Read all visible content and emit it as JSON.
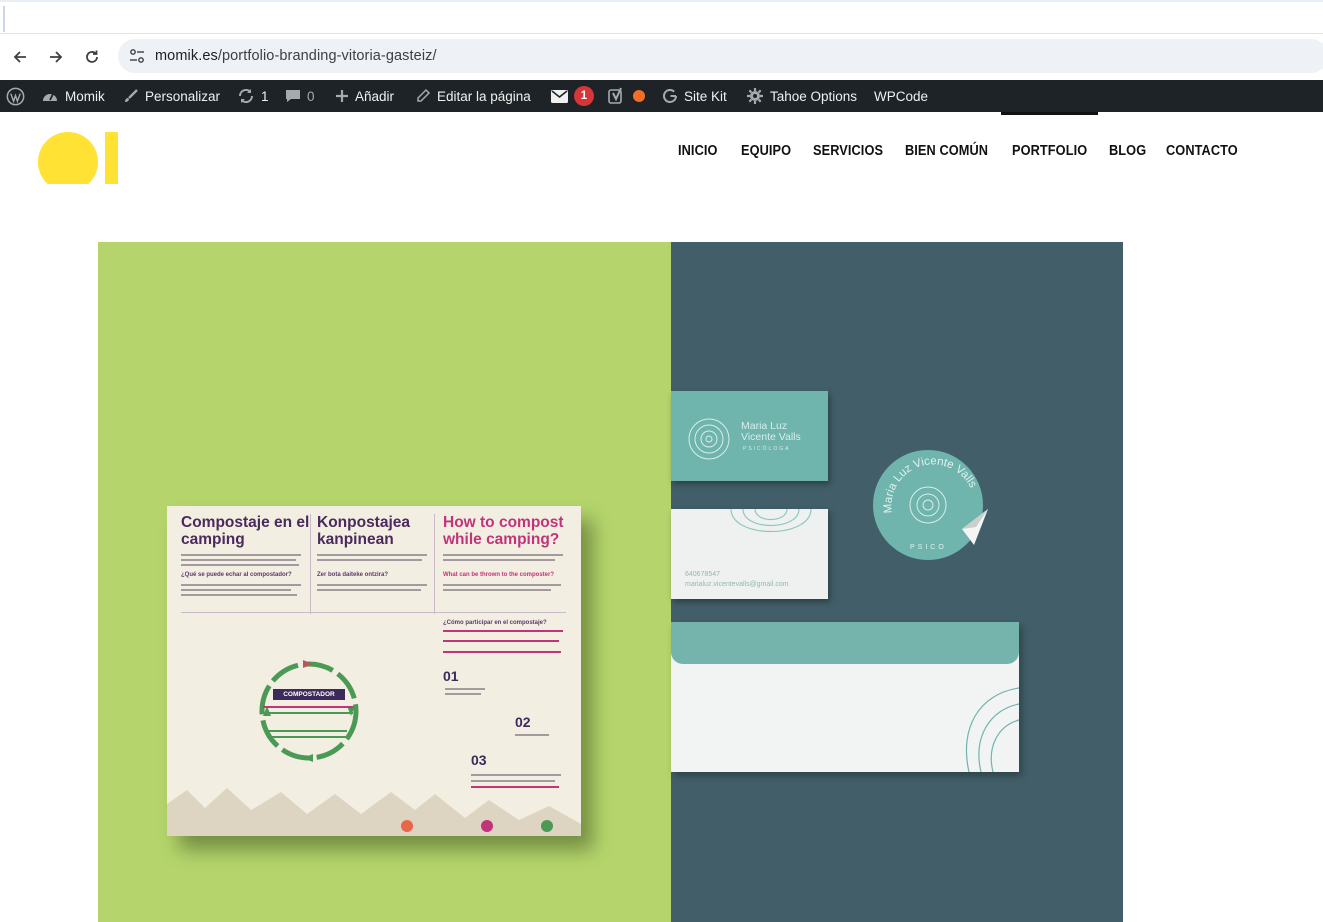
{
  "browser": {
    "url_host": "momik.es",
    "url_path": "/portfolio-branding-vitoria-gasteiz/",
    "back_icon": "arrow-left-icon",
    "forward_icon": "arrow-right-icon",
    "reload_icon": "reload-icon"
  },
  "adminbar": {
    "site_name": "Momik",
    "customize": "Personalizar",
    "updates_count": "1",
    "comments_count": "0",
    "add_new": "Añadir",
    "edit_page": "Editar la página",
    "mail_count": "1",
    "site_kit": "Site Kit",
    "tahoe_options": "Tahoe Options",
    "wpcode": "WPCode"
  },
  "nav": {
    "items": [
      "INICIO",
      "EQUIPO",
      "SERVICIOS",
      "BIEN COMÚN",
      "PORTFOLIO",
      "BLOG",
      "CONTACTO"
    ],
    "active": "PORTFOLIO"
  },
  "poster": {
    "col1_title": "Compostaje en el camping",
    "col2_title": "Konpostajea kanpinean",
    "col3_title": "How to compost while camping?",
    "col1_question": "¿Qué se puede echar al compostador?",
    "col2_question": "Zer bota daiteke ontzira?",
    "col3_question": "What can be thrown to the composter?",
    "participate": "¿Cómo participar en el compostaje?",
    "center_label": "COMPOSTADOR",
    "steps": [
      "01",
      "02",
      "03"
    ]
  },
  "stationery": {
    "card_name_1": "Maria Luz",
    "card_name_2": "Vicente Valls",
    "card_subtitle": "PSICÓLOGA",
    "phone": "640678547",
    "email": "marialuz.vicentevalls@gmail.com",
    "sticker_text": "Maria Luz Vicente Valls",
    "sticker_sub": "PSICO"
  },
  "colors": {
    "adminbar_bg": "#1d2327",
    "hero_left": "#b5d56c",
    "hero_right": "#425f69",
    "logo_yellow": "#ffe234",
    "teal": "#6fb4ad"
  }
}
